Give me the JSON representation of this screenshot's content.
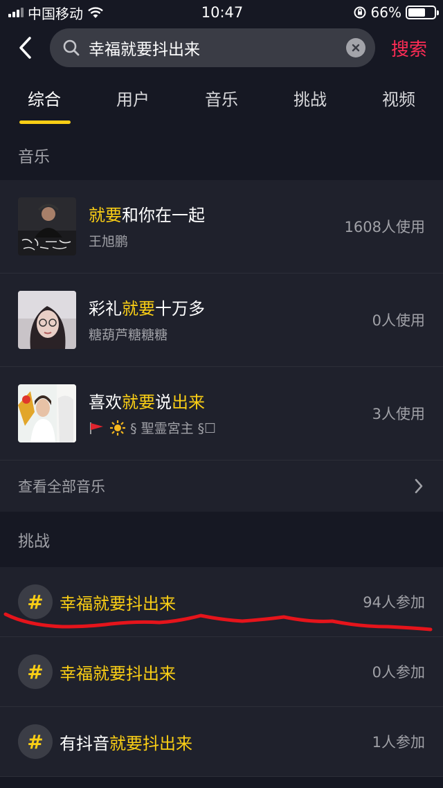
{
  "status": {
    "carrier": "中国移动",
    "time": "10:47",
    "battery": "66%",
    "battery_level": 0.66
  },
  "search": {
    "query": "幸福就要抖出来",
    "button_label": "搜索"
  },
  "tabs": [
    {
      "label": "综合",
      "active": true
    },
    {
      "label": "用户"
    },
    {
      "label": "音乐"
    },
    {
      "label": "挑战"
    },
    {
      "label": "视频"
    }
  ],
  "music_section": {
    "title": "音乐",
    "items": [
      {
        "title_a": "",
        "title_hl": "就要",
        "title_b": "和你在一起",
        "title_hl2": "",
        "title_c": "",
        "artist": "王旭鹏",
        "count": "1608人使用"
      },
      {
        "title_a": "彩礼",
        "title_hl": "就要",
        "title_b": "十万多",
        "title_hl2": "",
        "title_c": "",
        "artist": "糖葫芦糖糖糖",
        "count": "0人使用"
      },
      {
        "title_a": "喜欢",
        "title_hl": "就要",
        "title_b": "说",
        "title_hl2": "出来",
        "title_c": "",
        "artist": "§ 聖霊宮主 §☐",
        "count": "3人使用"
      }
    ],
    "view_all": "查看全部音乐"
  },
  "challenge_section": {
    "title": "挑战",
    "items": [
      {
        "prefix": "",
        "hl": "幸福就要抖出来",
        "count": "94人参加"
      },
      {
        "prefix": "",
        "hl": "幸福就要抖出来",
        "count": "0人参加"
      },
      {
        "prefix": "有抖音",
        "hl": "就要抖出来",
        "count": "1人参加"
      }
    ]
  },
  "colors": {
    "background": "#161823",
    "card": "#1f212c",
    "highlight": "#face15",
    "accent": "#fe2c55",
    "annotation": "#e5141b"
  },
  "icons": {
    "back": "back-chevron-icon",
    "search": "search-icon",
    "clear": "clear-icon",
    "more": "chevron-right-icon",
    "hashtag": "hashtag-icon"
  }
}
